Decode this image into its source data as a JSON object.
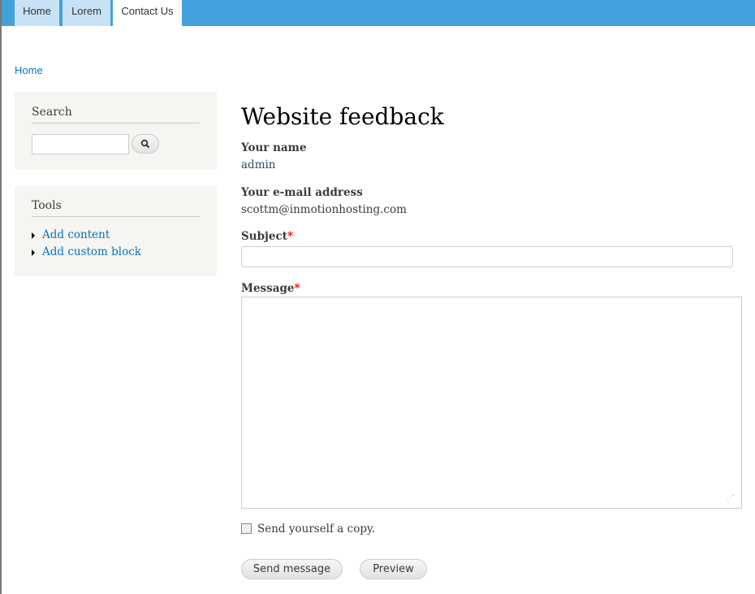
{
  "nav": {
    "tabs": [
      {
        "label": "Home"
      },
      {
        "label": "Lorem"
      },
      {
        "label": "Contact Us"
      }
    ]
  },
  "breadcrumb": "Home",
  "sidebar": {
    "search": {
      "title": "Search",
      "value": ""
    },
    "tools": {
      "title": "Tools",
      "items": [
        {
          "label": "Add content"
        },
        {
          "label": "Add custom block"
        }
      ]
    }
  },
  "form": {
    "title": "Website feedback",
    "name_label": "Your name",
    "name_value": "admin",
    "email_label": "Your e-mail address",
    "email_value": "scottm@inmotionhosting.com",
    "subject_label": "Subject",
    "subject_value": "",
    "message_label": "Message",
    "message_value": "",
    "required_mark": "*",
    "copy_label": "Send yourself a copy.",
    "send_label": "Send message",
    "preview_label": "Preview"
  }
}
